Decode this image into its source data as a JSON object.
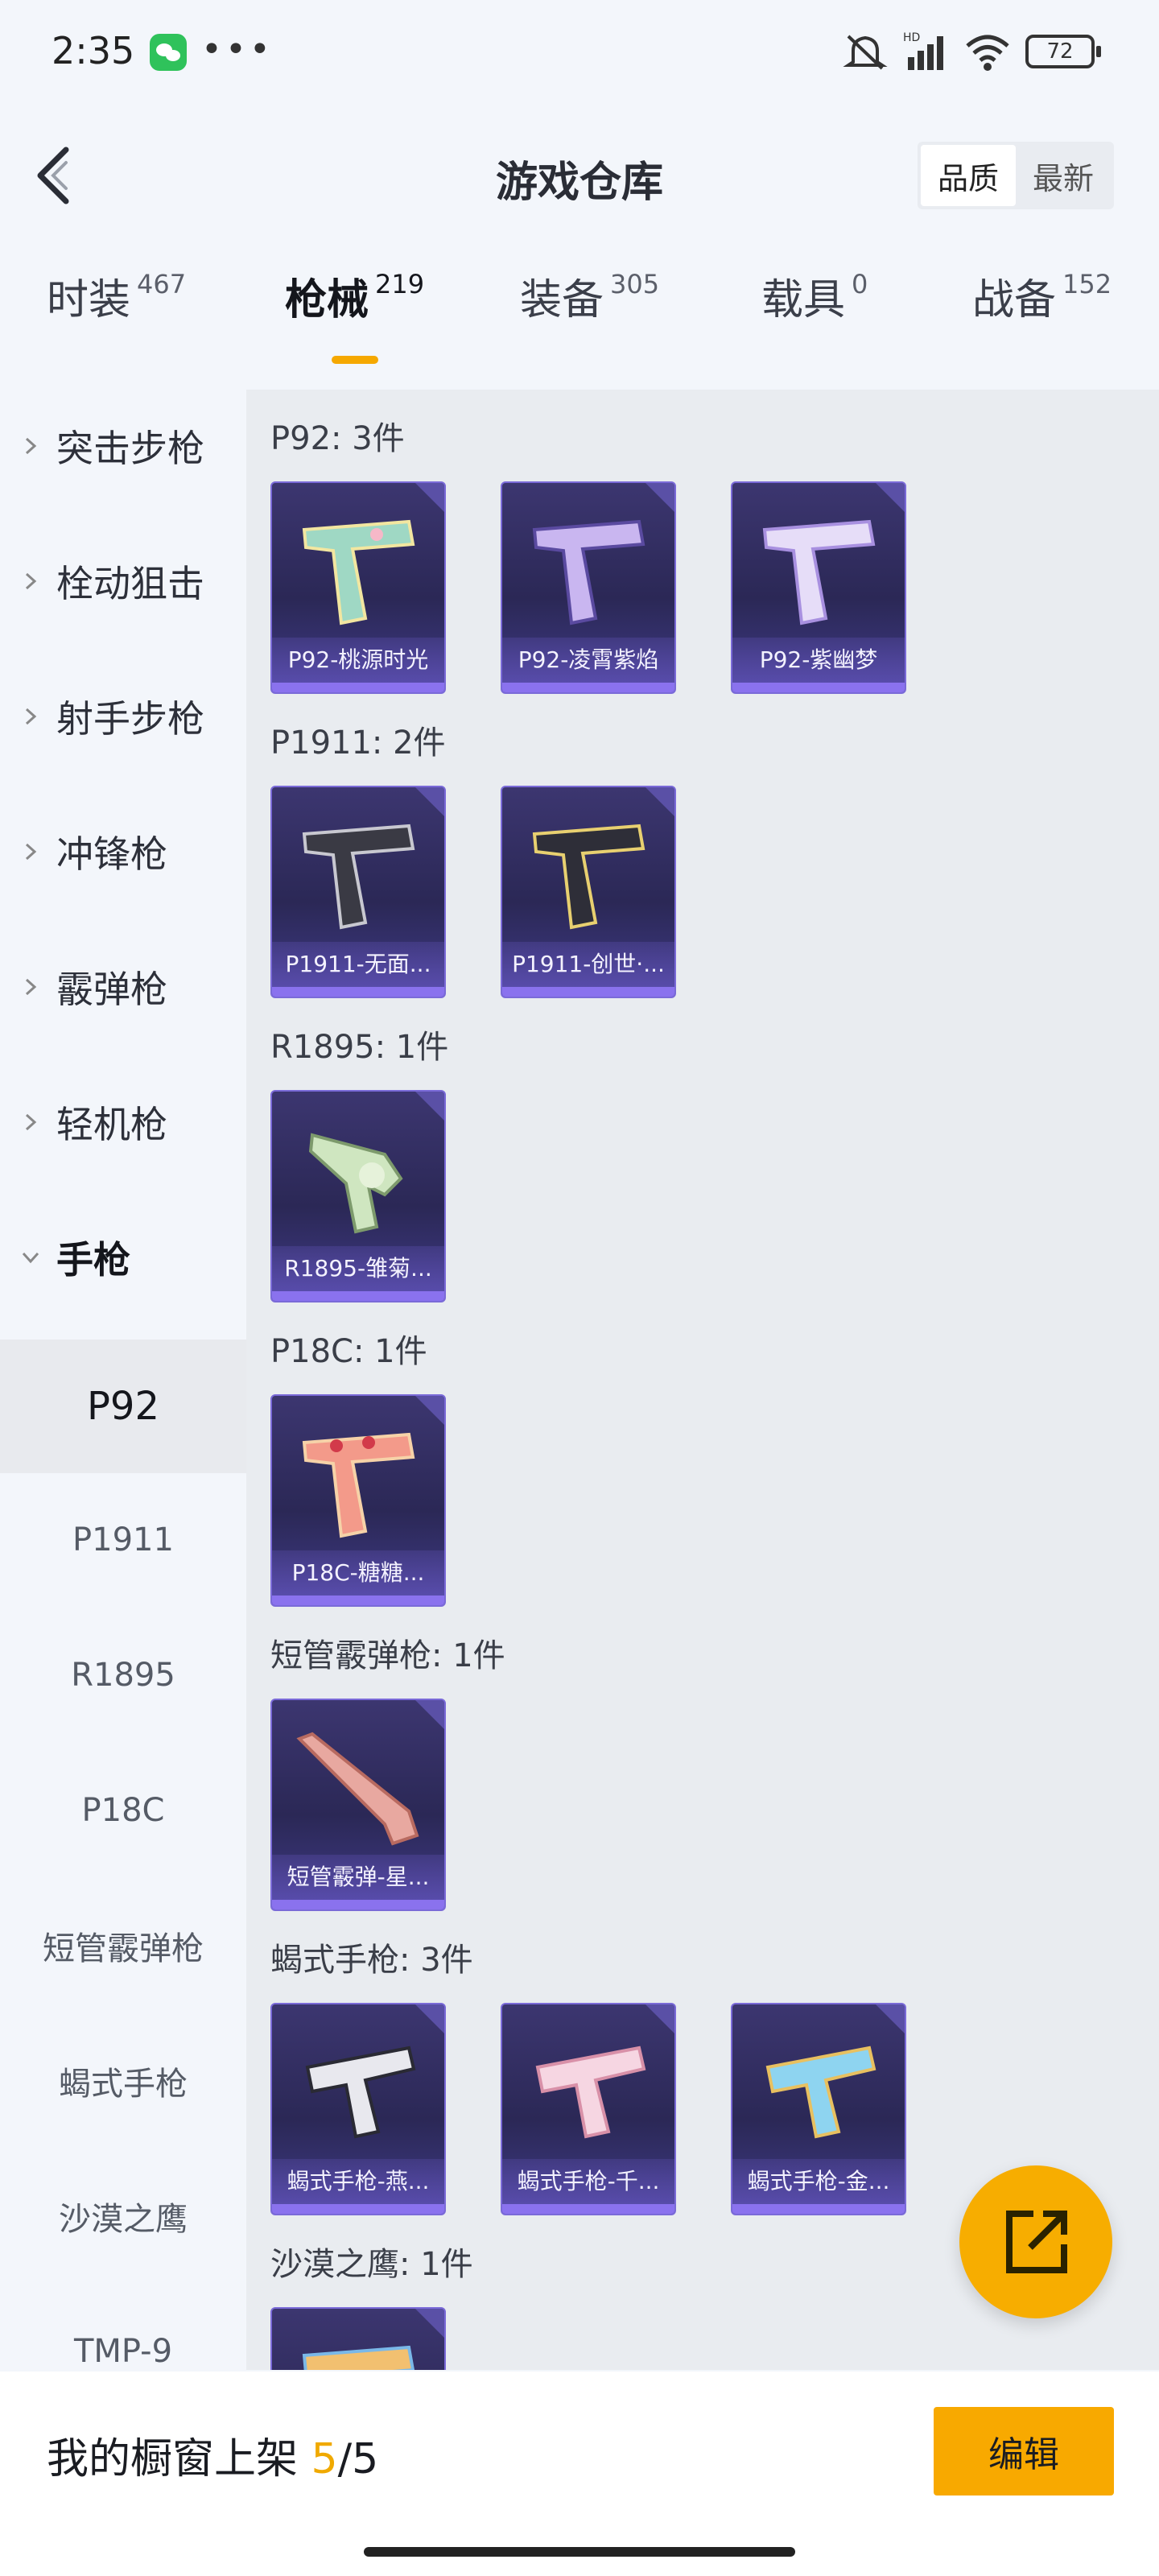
{
  "status_bar": {
    "time": "2:35",
    "battery": "72"
  },
  "header": {
    "title": "游戏仓库",
    "sort": [
      "品质",
      "最新"
    ],
    "sort_active": "品质"
  },
  "tabs": [
    {
      "label": "时装",
      "count": "467"
    },
    {
      "label": "枪械",
      "count": "219"
    },
    {
      "label": "装备",
      "count": "305"
    },
    {
      "label": "载具",
      "count": "0"
    },
    {
      "label": "战备",
      "count": "152"
    }
  ],
  "sidebar": {
    "categories": [
      "突击步枪",
      "栓动狙击",
      "射手步枪",
      "冲锋枪",
      "霰弹枪",
      "轻机枪",
      "手枪"
    ],
    "subitems": [
      "P92",
      "P1911",
      "R1895",
      "P18C",
      "短管霰弹枪",
      "蝎式手枪",
      "沙漠之鹰",
      "TMP-9"
    ]
  },
  "groups": [
    {
      "title": "P92: 3件",
      "items": [
        "P92-桃源时光",
        "P92-凌霄紫焰",
        "P92-紫幽梦"
      ]
    },
    {
      "title": "P1911: 2件",
      "items": [
        "P1911-无面...",
        "P1911-创世·..."
      ]
    },
    {
      "title": "R1895: 1件",
      "items": [
        "R1895-雏菊..."
      ]
    },
    {
      "title": "P18C: 1件",
      "items": [
        "P18C-糖糖..."
      ]
    },
    {
      "title": "短管霰弹枪: 1件",
      "items": [
        "短管霰弹-星..."
      ]
    },
    {
      "title": "蝎式手枪: 3件",
      "items": [
        "蝎式手枪-燕...",
        "蝎式手枪-千...",
        "蝎式手枪-金..."
      ]
    },
    {
      "title": "沙漠之鹰: 1件",
      "items": [
        ""
      ]
    }
  ],
  "bottom": {
    "label": "我的橱窗上架 ",
    "count": "5",
    "total": "/5",
    "edit": "编辑"
  },
  "colors": {
    "accent": "#f8a900",
    "card_border": "#7a6ad8"
  }
}
